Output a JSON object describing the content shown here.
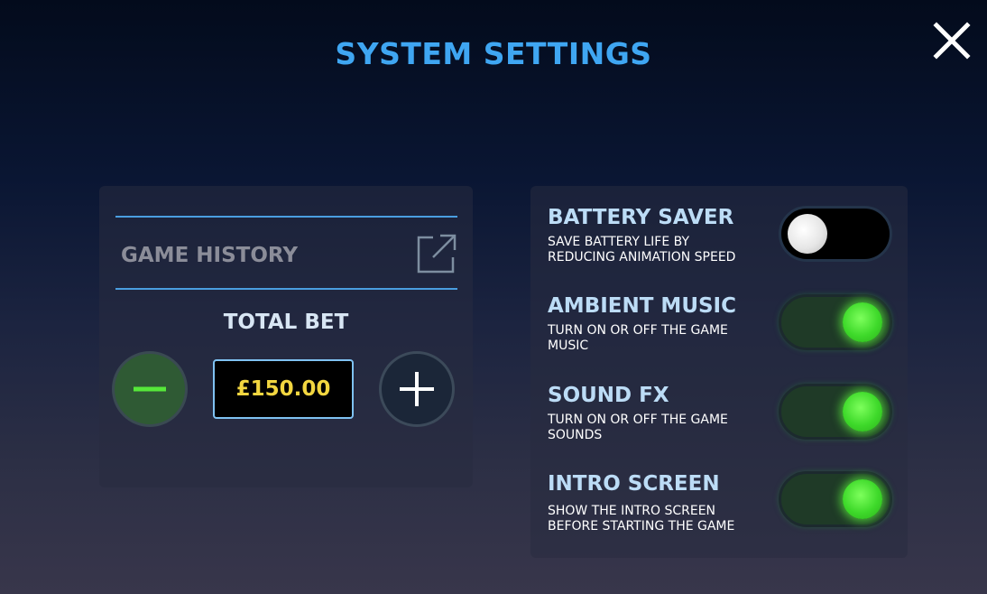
{
  "header": {
    "title": "SYSTEM SETTINGS"
  },
  "left_panel": {
    "game_history_label": "GAME HISTORY",
    "total_bet_label": "TOTAL BET",
    "bet_value": "£150.00"
  },
  "options": [
    {
      "title": "BATTERY SAVER",
      "desc_line1": "SAVE BATTERY LIFE BY",
      "desc_line2": "REDUCING ANIMATION SPEED",
      "enabled": false
    },
    {
      "title": "AMBIENT MUSIC",
      "desc_line1": "TURN ON OR OFF THE GAME",
      "desc_line2": "MUSIC",
      "enabled": true
    },
    {
      "title": "SOUND FX",
      "desc_line1": "TURN ON OR OFF THE GAME",
      "desc_line2": "SOUNDS",
      "enabled": true
    },
    {
      "title": "INTRO SCREEN",
      "desc_line1": "SHOW THE INTRO SCREEN",
      "desc_line2": "BEFORE STARTING THE GAME",
      "enabled": true
    }
  ],
  "colors": {
    "title": "#3fa6f2",
    "accent_green": "#3ed92a",
    "bet_text": "#f2d640",
    "divider": "#4a9ee0"
  },
  "icons": {
    "close": "close-icon",
    "external_link": "external-link-icon",
    "minus": "minus-icon",
    "plus": "plus-icon"
  }
}
